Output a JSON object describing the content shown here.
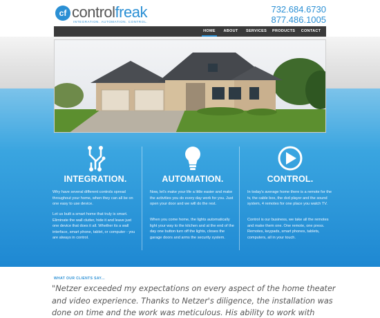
{
  "brand": {
    "mark": "cf",
    "name_part1": "control",
    "name_part2": "freak",
    "tagline": "INTEGRATION. AUTOMATION. CONTROL.",
    "accent_color": "#2a8fd4"
  },
  "phones": [
    "732.684.6730",
    "877.486.1005"
  ],
  "nav": [
    {
      "label": "HOME",
      "active": true
    },
    {
      "label": "ABOUT",
      "active": false
    },
    {
      "label": "SERVICES",
      "active": false
    },
    {
      "label": "PRODUCTS",
      "active": false
    },
    {
      "label": "CONTACT",
      "active": false
    }
  ],
  "features": [
    {
      "icon": "circuit-icon",
      "title": "INTEGRATION.",
      "paragraphs": [
        "Why have several different controls spread throughout your home, when they can all be on one easy to use device.",
        "Let us built a smart home that truly is smart. Eliminate the wall clutter, hide it and leave just one device that does it all. Whether its a wall interface, smart phone, tablet, or computer - you are always in control."
      ]
    },
    {
      "icon": "lightbulb-icon",
      "title": "AUTOMATION.",
      "paragraphs": [
        "Now, let's make your life a little easier and make the activities you do every day work for you. Just open your door and we will do the rest.",
        "When you come home, the lights automatically light your way to the kitchen and at the end of the day one button turn off the lights, closes the garage doors and arms the security system."
      ]
    },
    {
      "icon": "play-icon",
      "title": "CONTROL.",
      "paragraphs": [
        "In today's average home there is a remote for the tv, the cable box, the dvd player and the sound system, 4 remotes for one place you watch TV.",
        "Control is our business, we take all the remotes and make them one. One remote, one press. Remotes, keypads, smart phones, tablets, computers, all in your touch."
      ]
    }
  ],
  "testimonials": {
    "label": "WHAT OUR CLIENTS SAY...",
    "quote": "\"Netzer exceeded my expectations on every aspect of the home theater and video experience. Thanks to Netzer's diligence, the installation was done on time and the work was meticulous. His ability to work with"
  }
}
